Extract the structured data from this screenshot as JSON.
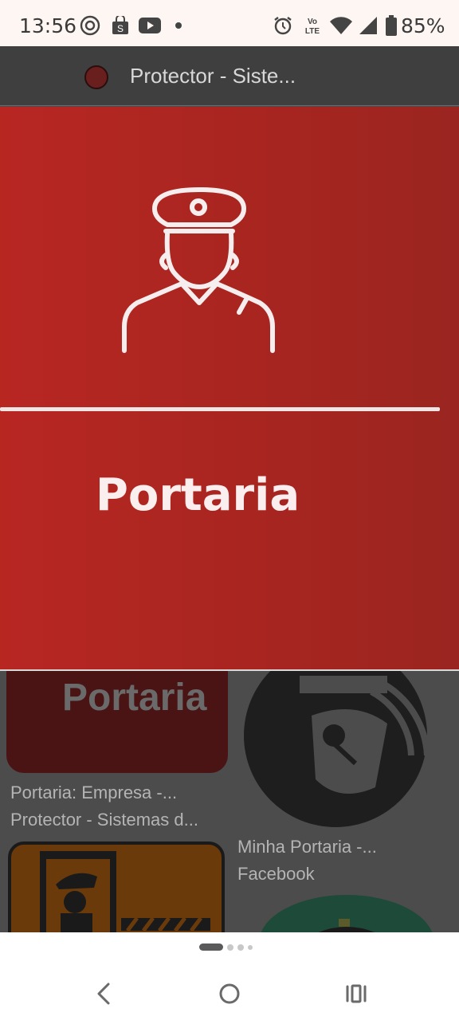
{
  "status_bar": {
    "time": "13:56",
    "battery": "85%",
    "icons": [
      "threads-icon",
      "shopping-bag-icon",
      "youtube-icon",
      "dot-icon",
      "alarm-icon",
      "volte-icon",
      "wifi-icon",
      "signal-icon",
      "battery-icon"
    ]
  },
  "header": {
    "title": "Protector - Siste..."
  },
  "preview": {
    "label": "Portaria",
    "accent_color": "#b82622"
  },
  "results": [
    {
      "tile_text": "Portaria",
      "caption_line1": "Portaria: Empresa -...",
      "caption_line2": "Protector - Sistemas d..."
    },
    {
      "caption_line1": "Minha Portaria -...",
      "caption_line2": "Facebook"
    }
  ],
  "navigation": {
    "back": "back-icon",
    "home": "home-icon",
    "recents": "recents-icon"
  }
}
